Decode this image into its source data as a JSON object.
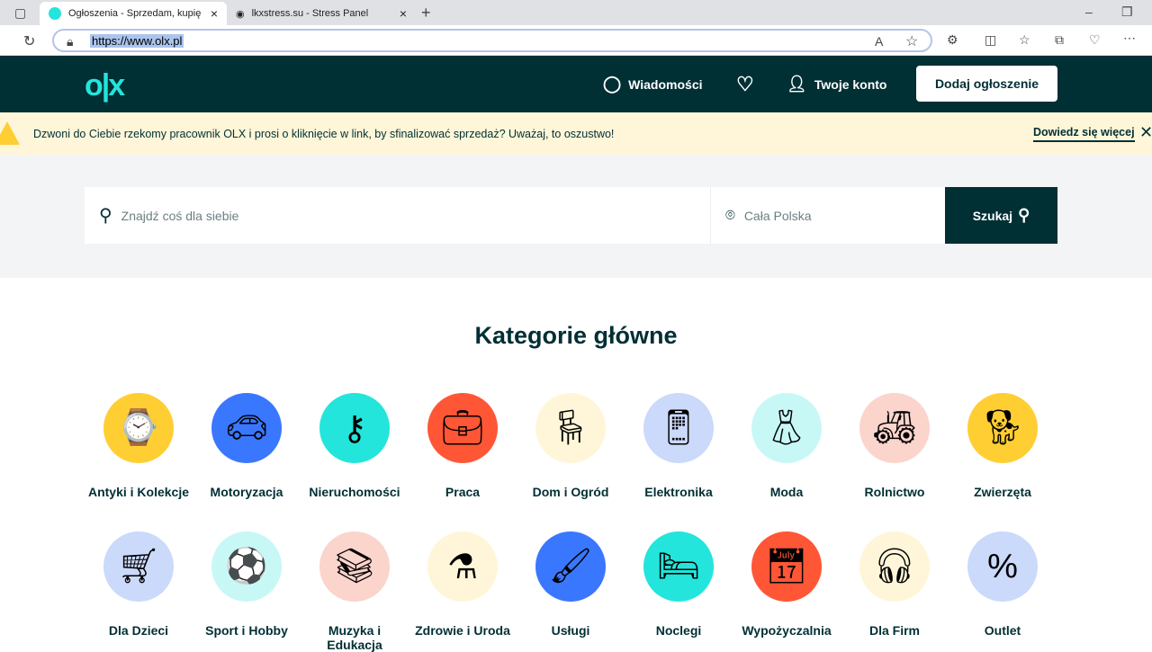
{
  "browser": {
    "tabs": [
      {
        "title": "Ogłoszenia - Sprzedam, kupię na"
      },
      {
        "title": "lkxstress.su - Stress Panel"
      }
    ],
    "url": "https://www.olx.pl"
  },
  "header": {
    "logo": "olx",
    "messages": "Wiadomości",
    "account": "Twoje konto",
    "add": "Dodaj ogłoszenie"
  },
  "banner": {
    "message": "Dzwoni do Ciebie rzekomy pracownik OLX i prosi o kliknięcie w link, by sfinalizować sprzedaż? Uważaj, to oszustwo!",
    "more": "Dowiedz się więcej"
  },
  "search": {
    "placeholder": "Znajdź coś dla siebie",
    "location": "Cała Polska",
    "button": "Szukaj"
  },
  "categories": {
    "title": "Kategorie główne",
    "items": [
      {
        "label": "Antyki i Kolekcje",
        "color": "#ffce32",
        "icon": "pocket-watch"
      },
      {
        "label": "Motoryzacja",
        "color": "#3a77ff",
        "icon": "car"
      },
      {
        "label": "Nieruchomości",
        "color": "#23e5db",
        "icon": "key"
      },
      {
        "label": "Praca",
        "color": "#ff5636",
        "icon": "briefcase"
      },
      {
        "label": "Dom i Ogród",
        "color": "#fff6d9",
        "icon": "armchair"
      },
      {
        "label": "Elektronika",
        "color": "#cbd9fa",
        "icon": "smartphone"
      },
      {
        "label": "Moda",
        "color": "#c8f8f6",
        "icon": "dress"
      },
      {
        "label": "Rolnictwo",
        "color": "#fbd4cc",
        "icon": "tractor"
      },
      {
        "label": "Zwierzęta",
        "color": "#ffce32",
        "icon": "dog"
      },
      {
        "label": "Dla Dzieci",
        "color": "#cbd9fa",
        "icon": "stroller"
      },
      {
        "label": "Sport i Hobby",
        "color": "#c8f8f6",
        "icon": "soccer-ball"
      },
      {
        "label": "Muzyka i Edukacja",
        "color": "#fbd4cc",
        "icon": "books"
      },
      {
        "label": "Zdrowie i Uroda",
        "color": "#fff6d9",
        "icon": "perfume"
      },
      {
        "label": "Usługi",
        "color": "#3a77ff",
        "icon": "paint-roller"
      },
      {
        "label": "Noclegi",
        "color": "#23e5db",
        "icon": "bed"
      },
      {
        "label": "Wypożyczalnia",
        "color": "#ff5636",
        "icon": "calendar"
      },
      {
        "label": "Dla Firm",
        "color": "#fff6d9",
        "icon": "headphones"
      },
      {
        "label": "Outlet",
        "color": "#cbd9fa",
        "icon": "price-tag"
      }
    ]
  }
}
